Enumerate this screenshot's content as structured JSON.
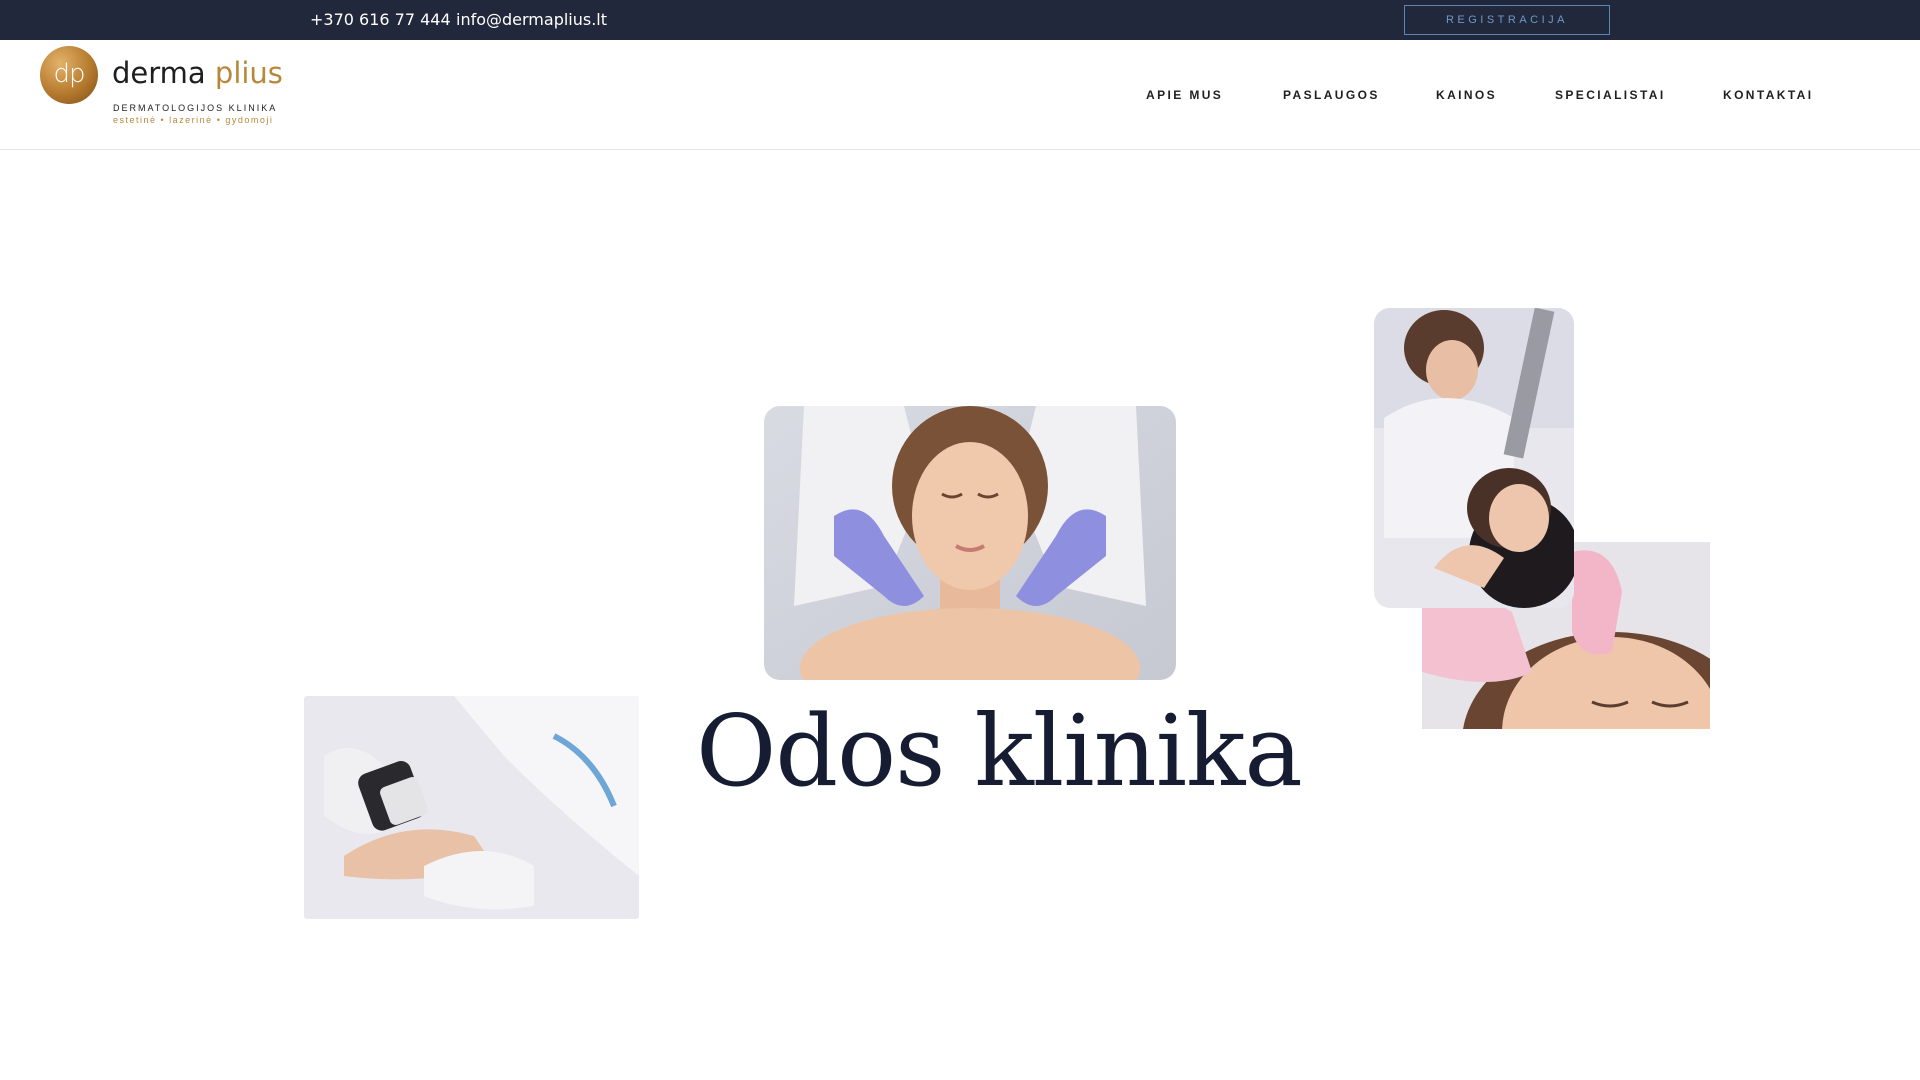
{
  "topbar": {
    "phone": "+370 616 77 444",
    "email": "info@dermaplius.lt",
    "register_label": "REGISTRACIJA",
    "background": "#22283b"
  },
  "logo": {
    "monogram": "dp",
    "brand_main": "derma",
    "brand_accent": "plius",
    "subtitle": "DERMATOLOGIJOS KLINIKA",
    "tagline": "estetinė • lazerinė • gydomoji",
    "accent_color": "#b8883a"
  },
  "nav": {
    "items": [
      {
        "label": "APIE MUS"
      },
      {
        "label": "PASLAUGOS"
      },
      {
        "label": "KAINOS"
      },
      {
        "label": "SPECIALISTAI"
      },
      {
        "label": "KONTAKTAI"
      }
    ]
  },
  "hero": {
    "title": "Odos klinika",
    "title_color": "#161d33"
  }
}
